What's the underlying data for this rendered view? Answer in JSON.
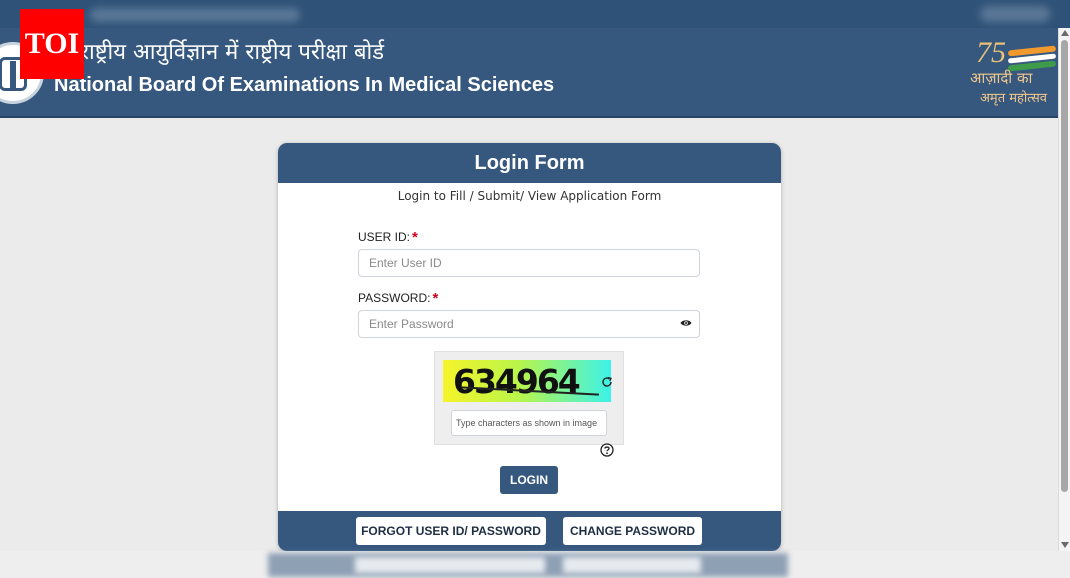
{
  "header": {
    "badge": "TOI",
    "hindi_title": "राष्ट्रीय आयुर्विज्ञान में राष्ट्रीय परीक्षा बोर्ड",
    "english_title": "National Board Of Examinations In Medical Sciences",
    "azadi": {
      "number": "75",
      "line1": "आज़ादी का",
      "line2": "अमृत महोत्सव"
    }
  },
  "form": {
    "title": "Login Form",
    "subtitle": "Login to Fill / Submit/ View Application Form",
    "user_id": {
      "label": "USER ID:",
      "required_mark": "*",
      "placeholder": "Enter User ID",
      "value": ""
    },
    "password": {
      "label": "PASSWORD:",
      "required_mark": "*",
      "placeholder": "Enter Password",
      "value": ""
    },
    "captcha": {
      "code": "634964",
      "placeholder": "Type characters as shown in image",
      "value": ""
    },
    "login_label": "LOGIN",
    "forgot_label": "FORGOT USER ID/ PASSWORD",
    "change_password_label": "CHANGE PASSWORD"
  },
  "icons": {
    "emblem": "nbems-emblem-icon",
    "toggle_password": "eye-icon",
    "refresh_captcha": "refresh-icon",
    "captcha_help": "question-icon"
  },
  "colors": {
    "header_bg": "#36587f",
    "page_bg": "#ebebeb",
    "required": "#d0021b",
    "badge": "#ff0000"
  }
}
